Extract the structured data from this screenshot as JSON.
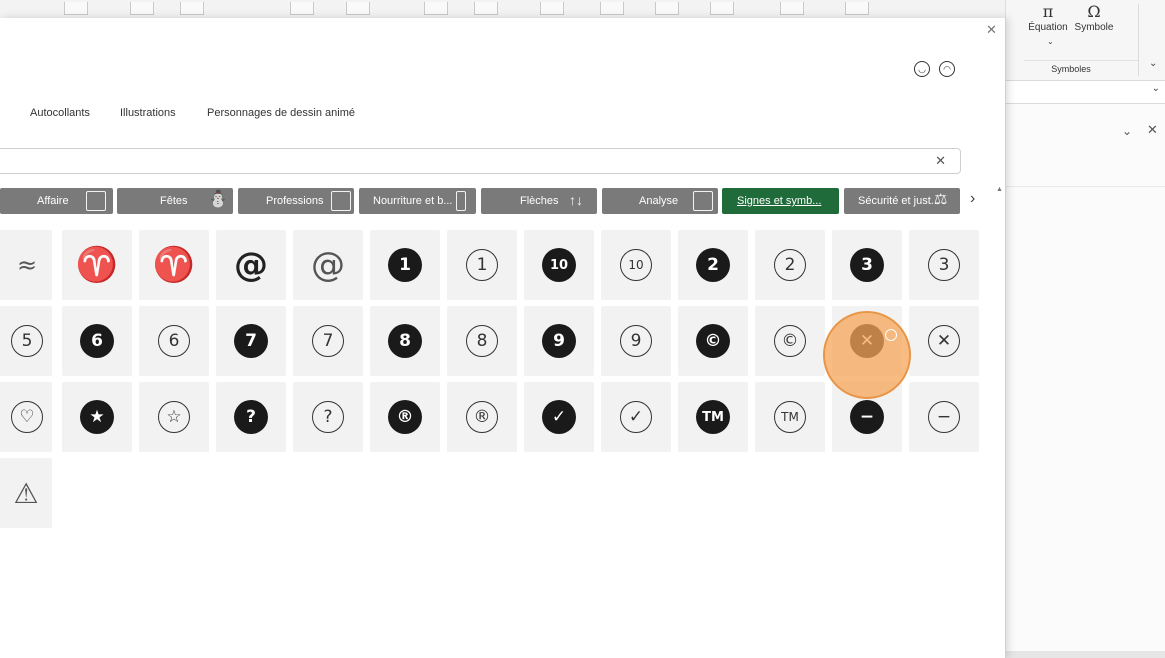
{
  "ribbon": {
    "equation_label": "Équation",
    "symbol_label": "Symbole",
    "equation_glyph": "π",
    "symbol_glyph": "Ω",
    "group_label": "Symboles"
  },
  "dialog": {
    "top_tabs": [
      "Autocollants",
      "Illustrations",
      "Personnages de dessin animé"
    ],
    "search_value": "",
    "categories": [
      {
        "label": "Affaire",
        "selected": false
      },
      {
        "label": "Fêtes",
        "selected": false
      },
      {
        "label": "Professions",
        "selected": false
      },
      {
        "label": "Nourriture et b...",
        "selected": false
      },
      {
        "label": "Flèches",
        "selected": false
      },
      {
        "label": "Analyse",
        "selected": false
      },
      {
        "label": "Signes et symb...",
        "selected": true
      },
      {
        "label": "Sécurité et just...",
        "selected": false
      }
    ]
  },
  "grid": {
    "row1": [
      "≈",
      "♈",
      "♈",
      "@",
      "@",
      "1",
      "1",
      "10",
      "10",
      "2",
      "2",
      "3",
      "3"
    ],
    "row2": [
      "5",
      "6",
      "6",
      "7",
      "7",
      "8",
      "8",
      "9",
      "9",
      "©",
      "©",
      "✕",
      "✕"
    ],
    "row3": [
      "♡",
      "★",
      "☆",
      "?",
      "?",
      "®",
      "®",
      "✓",
      "✓",
      "TM",
      "TM",
      "−",
      "−"
    ],
    "row4": [
      "⚠"
    ]
  },
  "colors": {
    "selected_chip": "#1f6b3a",
    "chip": "#7a7a7a",
    "cursor_highlight": "#f6a55a"
  }
}
